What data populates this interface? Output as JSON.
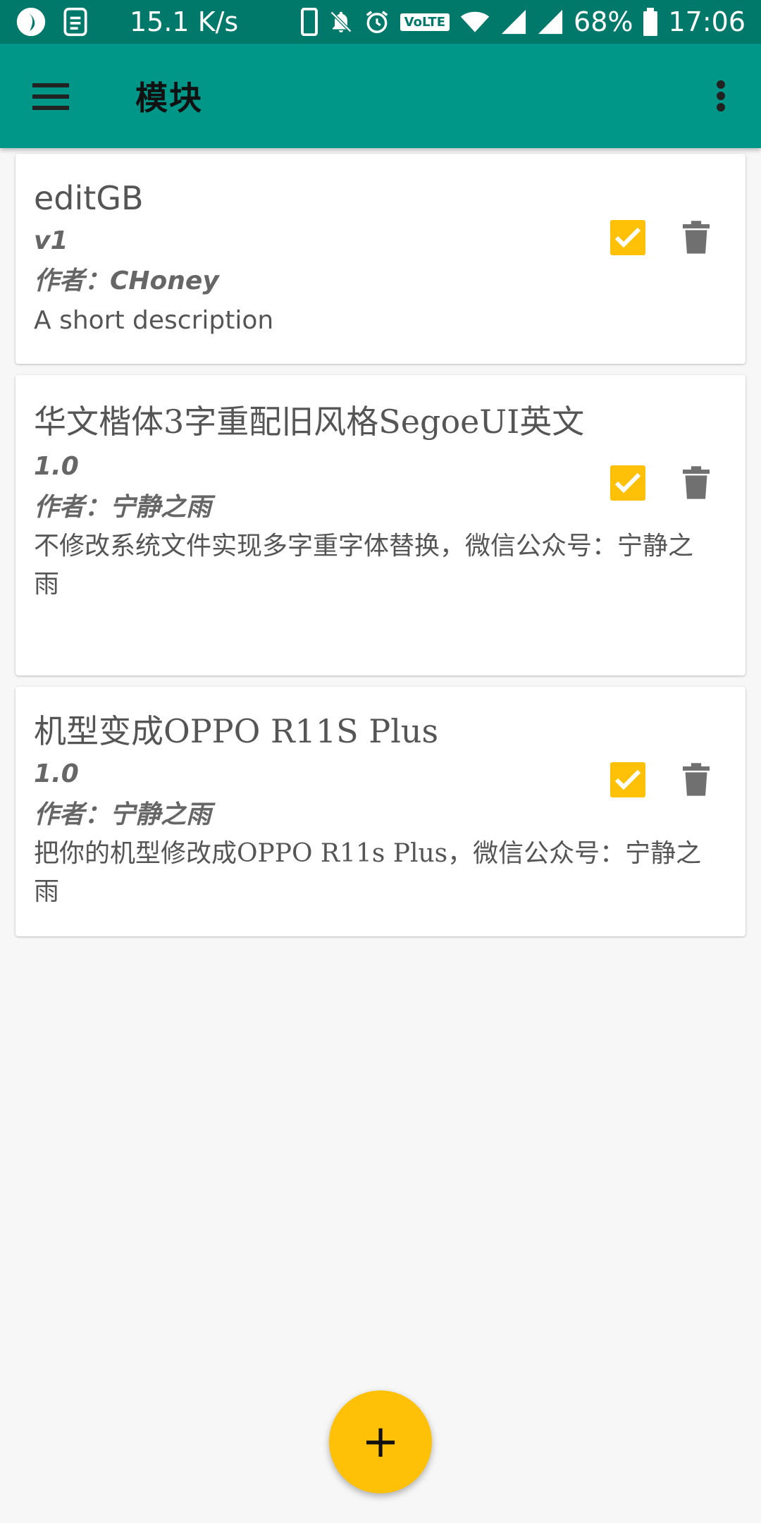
{
  "status_bar": {
    "speed": "15.1 K/s",
    "volte": "VoLTE",
    "battery": "68%",
    "time": "17:06"
  },
  "app_bar": {
    "title": "模块"
  },
  "modules": [
    {
      "name": "editGB",
      "version": "v1",
      "author": "作者：CHoney",
      "description": "A short description",
      "enabled": true
    },
    {
      "name": "华文楷体3字重配旧风格SegoeUI英文",
      "version": "1.0",
      "author": "作者：宁静之雨",
      "description": "不修改系统文件实现多字重字体替换，微信公众号：宁静之雨",
      "enabled": true
    },
    {
      "name": "机型变成OPPO R11S Plus",
      "version": "1.0",
      "author": "作者：宁静之雨",
      "description": "把你的机型修改成OPPO R11s Plus，微信公众号：宁静之雨",
      "enabled": true
    }
  ],
  "fab": {
    "label": "+"
  },
  "colors": {
    "status_bar": "#00796b",
    "app_bar": "#009688",
    "accent": "#ffc107",
    "background": "#f7f7f7"
  }
}
